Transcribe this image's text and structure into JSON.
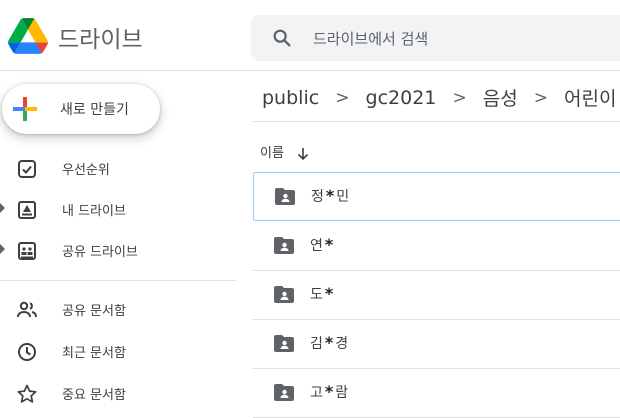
{
  "app": {
    "brand": "드라이브"
  },
  "search": {
    "placeholder": "드라이브에서 검색"
  },
  "new_button": {
    "label": "새로 만들기"
  },
  "sidebar": {
    "items": [
      {
        "label": "우선순위",
        "icon": "check-box-icon",
        "has_arrow": false
      },
      {
        "label": "내 드라이브",
        "icon": "my-drive-icon",
        "has_arrow": true
      },
      {
        "label": "공유 드라이브",
        "icon": "shared-drives-icon",
        "has_arrow": true
      },
      {
        "label": "공유 문서함",
        "icon": "people-icon",
        "has_arrow": false
      },
      {
        "label": "최근 문서함",
        "icon": "clock-icon",
        "has_arrow": false
      },
      {
        "label": "중요 문서함",
        "icon": "star-icon",
        "has_arrow": false
      }
    ]
  },
  "breadcrumb": {
    "items": [
      "public",
      "gc2021",
      "음성",
      "어린이"
    ],
    "separator": ">",
    "dropdown": "▾"
  },
  "file_list": {
    "column_name": "이름",
    "rows": [
      {
        "pre": "정",
        "mask": "*",
        "post": "민",
        "selected": true
      },
      {
        "pre": "연",
        "mask": "*",
        "post": "",
        "selected": false
      },
      {
        "pre": "도",
        "mask": "*",
        "post": "",
        "selected": false
      },
      {
        "pre": "김",
        "mask": "*",
        "post": "경",
        "selected": false
      },
      {
        "pre": "고",
        "mask": "*",
        "post": "람",
        "selected": false
      }
    ]
  },
  "colors": {
    "accent_blue": "#1a73e8",
    "selection_border": "#a8c7fa",
    "icon_gray": "#5f6368"
  }
}
